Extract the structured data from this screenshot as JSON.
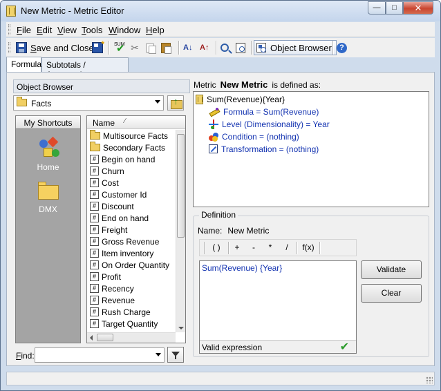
{
  "window": {
    "title": "New Metric - Metric Editor"
  },
  "menu": {
    "items": [
      {
        "label": "File",
        "key": "F",
        "rest": "ile"
      },
      {
        "label": "Edit",
        "key": "E",
        "rest": "dit"
      },
      {
        "label": "View",
        "key": "V",
        "rest": "iew"
      },
      {
        "label": "Tools",
        "key": "T",
        "rest": "ools"
      },
      {
        "label": "Window",
        "key": "W",
        "rest": "indow"
      },
      {
        "label": "Help",
        "key": "H",
        "rest": "elp"
      }
    ]
  },
  "toolbar": {
    "save_close_key": "S",
    "save_close_rest": "ave and Close",
    "object_browser_label": "Object Browser",
    "sum_label": "SUM"
  },
  "tabs": [
    {
      "label": "Formula",
      "active": true
    },
    {
      "label": "Subtotals / Aggregation",
      "active": false
    }
  ],
  "object_browser": {
    "title": "Object Browser",
    "folder": "Facts",
    "shortcuts_title": "My Shortcuts",
    "shortcuts": [
      {
        "label": "Home"
      },
      {
        "label": "DMX"
      }
    ],
    "list_header": "Name",
    "items": [
      {
        "label": "Multisource Facts",
        "type": "folder"
      },
      {
        "label": "Secondary Facts",
        "type": "folder"
      },
      {
        "label": "Begin on hand",
        "type": "fact"
      },
      {
        "label": "Churn",
        "type": "fact"
      },
      {
        "label": "Cost",
        "type": "fact"
      },
      {
        "label": "Customer Id",
        "type": "fact"
      },
      {
        "label": "Discount",
        "type": "fact"
      },
      {
        "label": "End on hand",
        "type": "fact"
      },
      {
        "label": "Freight",
        "type": "fact"
      },
      {
        "label": "Gross Revenue",
        "type": "fact"
      },
      {
        "label": "Item inventory",
        "type": "fact"
      },
      {
        "label": "On Order Quantity",
        "type": "fact"
      },
      {
        "label": "Profit",
        "type": "fact"
      },
      {
        "label": "Recency",
        "type": "fact"
      },
      {
        "label": "Revenue",
        "type": "fact"
      },
      {
        "label": "Rush Charge",
        "type": "fact"
      },
      {
        "label": "Target Quantity",
        "type": "fact"
      }
    ],
    "find_key": "F",
    "find_rest": "ind:",
    "find_value": ""
  },
  "definition": {
    "prefix": "Metric",
    "metric_name": "New Metric",
    "suffix": "is defined as:",
    "tree": {
      "root": "Sum(Revenue){Year}",
      "formula": "Formula = Sum(Revenue)",
      "level": "Level (Dimensionality) = Year",
      "condition": "Condition = (nothing)",
      "transformation": "Transformation = (nothing)"
    },
    "group_title": "Definition",
    "name_label": "Name:",
    "name_value": "New Metric",
    "operators": [
      "( )",
      "+",
      "-",
      "*",
      "/",
      "f(x)"
    ],
    "expression_text": "Sum(Revenue) {Year}",
    "status_text": "Valid expression",
    "validate_label": "Validate",
    "clear_label": "Clear"
  }
}
